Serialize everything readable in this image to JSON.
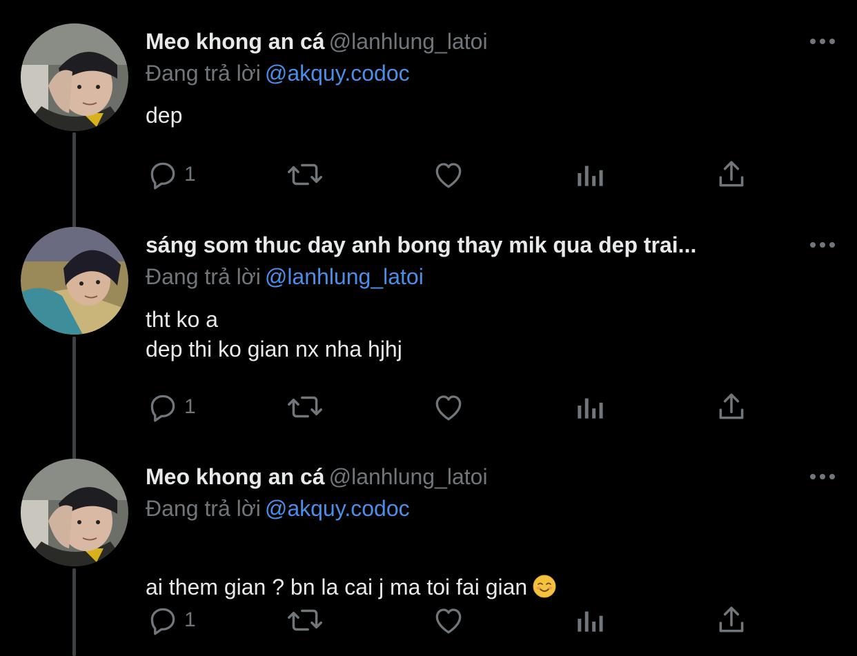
{
  "tweets": [
    {
      "display_name": "Meo khong an cá",
      "handle": "@lanhlung_latoi",
      "reply_prefix": "Đang trả lời",
      "reply_to": "@akquy.codoc",
      "text": "dep",
      "reply_count": "1",
      "avatar_icon": "user-photo-1"
    },
    {
      "display_name": "sáng som thuc day anh bong thay mik qua dep trai...",
      "handle": "",
      "reply_prefix": "Đang trả lời",
      "reply_to": "@lanhlung_latoi",
      "text": "tht ko a\ndep thi ko gian nx nha hjhj",
      "reply_count": "1",
      "avatar_icon": "user-photo-2"
    },
    {
      "display_name": "Meo khong an cá",
      "handle": "@lanhlung_latoi",
      "reply_prefix": "Đang trả lời",
      "reply_to": "@akquy.codoc",
      "text": "ai them gian ? bn la cai j ma toi fai gian",
      "text_emoji": "smiling-face-emoji",
      "reply_count": "1",
      "avatar_icon": "user-photo-1"
    }
  ],
  "icons": {
    "reply": "reply-icon",
    "retweet": "retweet-icon",
    "like": "heart-icon",
    "views": "analytics-icon",
    "share": "share-icon",
    "more": "more-dots-icon"
  },
  "colors": {
    "background": "#000000",
    "text": "#e7e9ea",
    "secondary": "#71767b",
    "mention": "#4a8fe7",
    "thread_line": "#3e4144"
  }
}
